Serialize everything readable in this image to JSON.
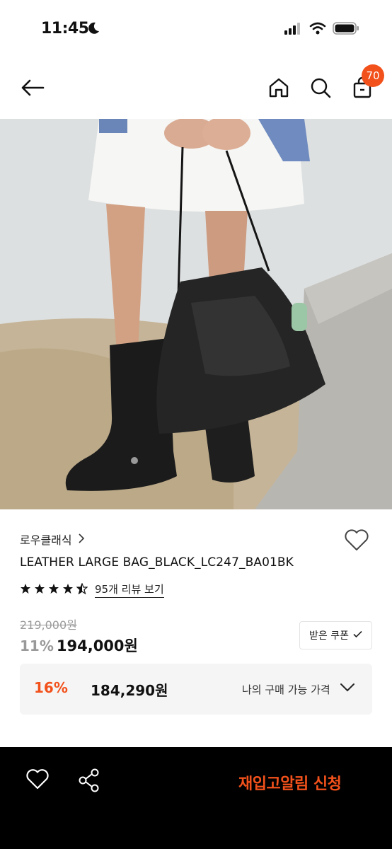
{
  "status": {
    "time": "11:45"
  },
  "header": {
    "cart_count": "70"
  },
  "product": {
    "brand": "로우클래식",
    "title": "LEATHER LARGE BAG_BLACK_LC247_BA01BK",
    "rating": 4.5,
    "review_link": "95개 리뷰 보기",
    "original_price": "219,000원",
    "discount_rate": "11%",
    "sale_price": "194,000원",
    "coupon_label": "받은 쿠폰",
    "my_discount_rate": "16%",
    "my_price": "184,290원",
    "my_price_label": "나의 구매 가능 가격"
  },
  "bottom_bar": {
    "cta_label": "재입고알림 신청"
  },
  "colors": {
    "accent": "#f2511b",
    "bottom_bar": "#000000"
  },
  "icons": [
    "back-arrow-icon",
    "home-icon",
    "search-icon",
    "shopping-bag-icon",
    "heart-icon",
    "share-icon",
    "chevron-right-icon",
    "chevron-down-icon",
    "check-icon",
    "star-icon"
  ]
}
